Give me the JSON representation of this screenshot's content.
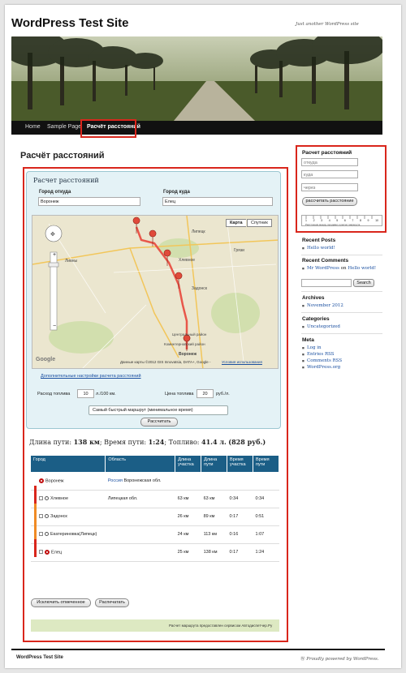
{
  "site": {
    "title": "WordPress Test Site",
    "tagline": "Just another WordPress site"
  },
  "nav": {
    "items": [
      "Home",
      "Sample Page",
      "Расчёт расстояний"
    ]
  },
  "entry": {
    "title": "Расчёт расстояний"
  },
  "calc": {
    "heading": "Расчет расстояний",
    "from_label": "Город откуда",
    "from_value": "Воронеж",
    "to_label": "Город куда",
    "to_value": "Елец",
    "map_btn": "Карта",
    "satellite_btn": "Спутник",
    "map_places": [
      "Липецк",
      "Грязи",
      "Хлевное",
      "Ливны",
      "Задонск",
      "Центральный район",
      "Коминтерновский район",
      "Воронеж"
    ],
    "map_logo": "Google",
    "map_credit": "Данные карты ©2012 GIS Innovatsia, DATA+, Google -",
    "map_terms": "Условия использования",
    "advanced_link": "Дополнительные настройки расчета расстояний",
    "fuel_label": "Расход топлива",
    "fuel_value": "10",
    "fuel_unit": "л./100 км.",
    "price_label": "Цена топлива",
    "price_value": "20",
    "price_unit": "руб./л.",
    "route_option": "Самый быстрый маршрут (минимальное время)",
    "calc_btn": "Рассчитать"
  },
  "summary": {
    "length_label": "Длина пути:",
    "length_value": "138 км",
    "time_label": "Время пути:",
    "time_value": "1:24",
    "fuel_label": "Топливо:",
    "fuel_value": "41.4 л.",
    "cost_value": "(828 руб.)"
  },
  "table": {
    "headers": [
      "Город",
      "Область",
      "Длина участка",
      "Длина пути",
      "Время участка",
      "Время пути"
    ],
    "rows": [
      {
        "city": "Воронеж",
        "region": "Воронежская обл.",
        "country": "Россия",
        "seg_len": "",
        "path_len": "",
        "seg_time": "",
        "path_time": ""
      },
      {
        "city": "Хлевное",
        "region": "Липецкая обл.",
        "country": "",
        "seg_len": "63 км",
        "path_len": "63 км",
        "seg_time": "0:34",
        "path_time": "0:34"
      },
      {
        "city": "Задонск",
        "region": "",
        "country": "",
        "seg_len": "26 км",
        "path_len": "89 км",
        "seg_time": "0:17",
        "path_time": "0:51"
      },
      {
        "city": "Екатериновка(Липецк)",
        "region": "",
        "country": "",
        "seg_len": "24 км",
        "path_len": "113 км",
        "seg_time": "0:16",
        "path_time": "1:07"
      },
      {
        "city": "Елец",
        "region": "",
        "country": "",
        "seg_len": "25 км",
        "path_len": "138 км",
        "seg_time": "0:17",
        "path_time": "1:24"
      }
    ],
    "exclude_btn": "Исключить отмеченное",
    "print_btn": "Распечатать",
    "footer_credit": "Расчет маршрута предоставлен сервисом Автодиспетчер.Ру"
  },
  "sidebar": {
    "widget_title": "Расчет расстояний",
    "from_placeholder": "откуда",
    "to_placeholder": "куда",
    "via_placeholder": "через",
    "calc_btn": "рассчитать расстояние",
    "ruler_nums": [
      "1",
      "2",
      "3",
      "4",
      "5",
      "6",
      "7",
      "8",
      "9",
      "10"
    ],
    "ruler_caption": "Расстояния между городами и расчет маршрута",
    "recent_posts_title": "Recent Posts",
    "recent_posts": [
      "Hello world!"
    ],
    "recent_comments_title": "Recent Comments",
    "recent_comment_author": "Mr WordPress",
    "recent_comment_on": "on",
    "recent_comment_post": "Hello world!",
    "search_btn": "Search",
    "archives_title": "Archives",
    "archives": [
      "November 2012"
    ],
    "categories_title": "Categories",
    "categories": [
      "Uncategorized"
    ],
    "meta_title": "Meta",
    "meta_links": [
      "Log in",
      "Entries RSS",
      "Comments RSS",
      "WordPress.org"
    ]
  },
  "footer": {
    "left": "WordPress Test Site",
    "right": "Proudly powered by WordPress."
  },
  "colors": {
    "highlight": "#d9261c",
    "table_header": "#1b5e86",
    "route": "#e8574a"
  }
}
